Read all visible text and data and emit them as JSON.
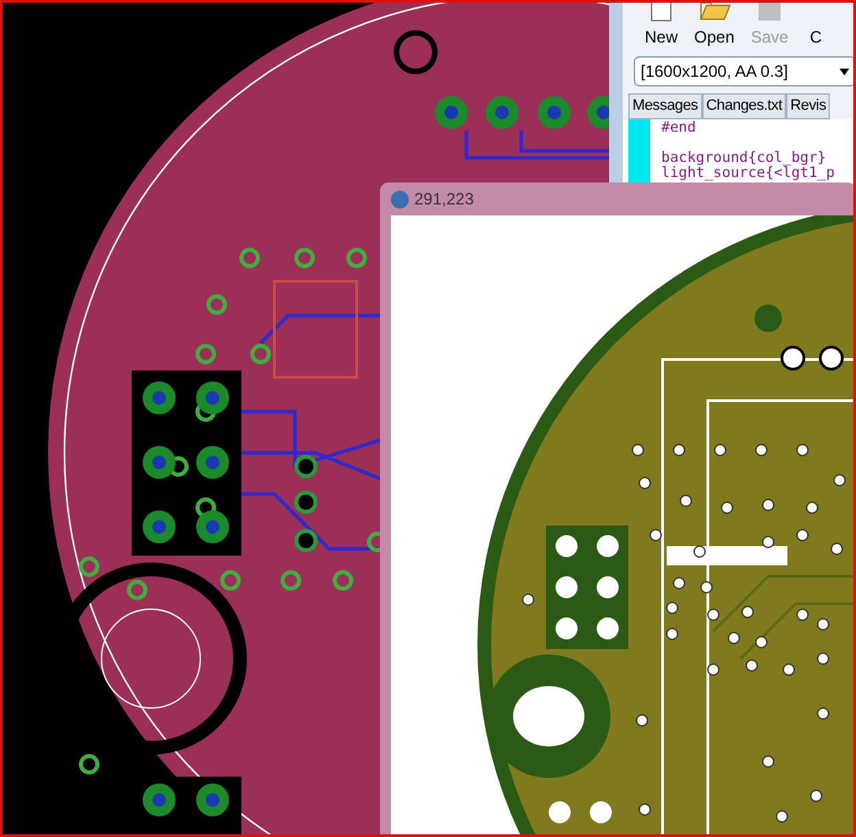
{
  "editor_window": {
    "toolbar": [
      {
        "label": "New",
        "kind": "page",
        "disabled": false
      },
      {
        "label": "Open",
        "kind": "folder",
        "disabled": false
      },
      {
        "label": "Save",
        "kind": "disk",
        "disabled": true
      },
      {
        "label": "C",
        "kind": "blank",
        "disabled": false
      }
    ],
    "resolution_select": {
      "value": "[1600x1200, AA 0.3]"
    },
    "tabs": [
      {
        "label": "Messages",
        "selected": false
      },
      {
        "label": "Changes.txt",
        "selected": false
      },
      {
        "label": "Revis",
        "selected": false
      }
    ],
    "code_lines": [
      {
        "text": "#end",
        "kind": "directive"
      },
      {
        "text": "background{col_bgr}",
        "kind": "statement"
      },
      {
        "text": "light_source{<lgt1_p",
        "kind": "statement"
      }
    ]
  },
  "render_window": {
    "title": "291,223"
  }
}
